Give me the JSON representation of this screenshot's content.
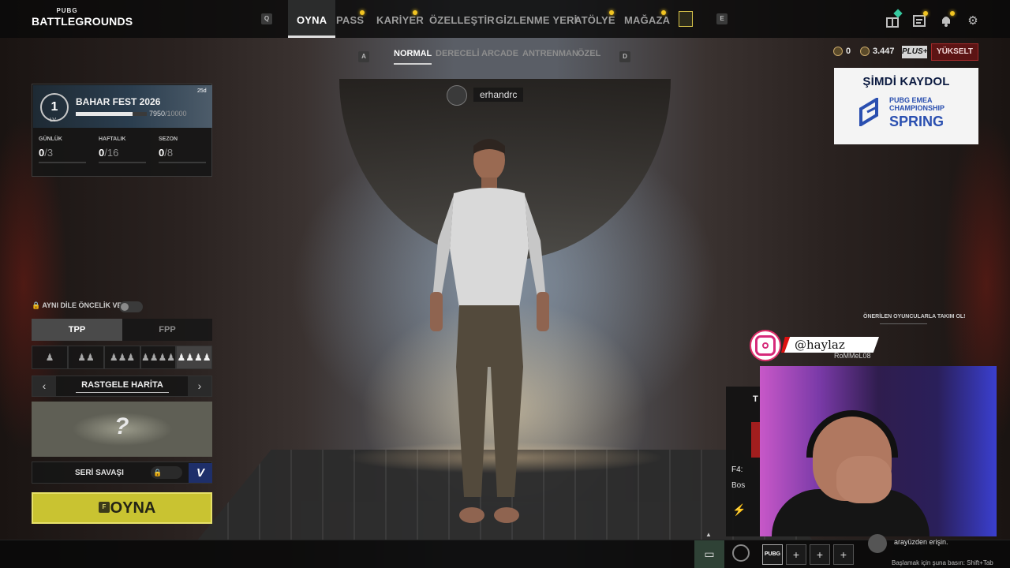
{
  "brand": {
    "small": "PUBG",
    "big": "BATTLEGROUNDS"
  },
  "nav": {
    "left_key": "Q",
    "right_key": "E",
    "items": [
      {
        "label": "OYNA",
        "active": true
      },
      {
        "label": "PASS",
        "dot": true
      },
      {
        "label": "KARİYER",
        "dot": true
      },
      {
        "label": "ÖZELLEŞTİR"
      },
      {
        "label": "GİZLENME YERİ"
      },
      {
        "label": "ATÖLYE",
        "dot": true
      },
      {
        "label": "MAĞAZA",
        "dot": true
      }
    ]
  },
  "modes": {
    "left_key": "A",
    "right_key": "D",
    "items": [
      "NORMAL",
      "DERECELİ",
      "ARCADE",
      "ANTRENMAN",
      "ÖZEL"
    ],
    "active": "NORMAL"
  },
  "currency": {
    "gcoin": "0",
    "bp": "3.447",
    "plus": "PLUS+",
    "upgrade": "YÜKSELT"
  },
  "ad": {
    "title": "ŞİMDİ KAYDOL",
    "line1": "PUBG EMEA",
    "line2": "CHAMPIONSHIP",
    "line3": "SPRING"
  },
  "player": {
    "name": "erhandrc"
  },
  "event": {
    "level": "1",
    "level_label": "LV",
    "title": "BAHAR FEST 2026",
    "progress_current": "7950",
    "progress_total": "/10000",
    "progress_fraction": 0.795,
    "days": "25d",
    "stats": [
      {
        "label": "GÜNLÜK",
        "value": "0",
        "max": "/3"
      },
      {
        "label": "HAFTALIK",
        "value": "0",
        "max": "/16"
      },
      {
        "label": "SEZON",
        "value": "0",
        "max": "/8"
      }
    ]
  },
  "lobby": {
    "lang_pref": "AYNI DİLE ÖNCELİK VER",
    "perspectives": [
      "TPP",
      "FPP"
    ],
    "active_perspective": "TPP",
    "map": "RASTGELE HARİTA",
    "series": "SERİ SAVAŞI",
    "series_badge": "V",
    "play_key": "F",
    "play_label": "OYNA"
  },
  "overlay": {
    "recommend": "ÖNERİLEN OYUNCULARLA TAKIM OL!",
    "handle": "@haylaz",
    "rommel": "RoMMeL08",
    "partial_t": "T",
    "partial_f4": "F4:",
    "partial_bos": "Bos"
  },
  "bottom": {
    "pubg_slot": "PUBG",
    "add": "+",
    "steam_line": "arayüzden erişin.",
    "shortcut": "Başlamak için şuna basın: Shift+Tab"
  },
  "colors": {
    "play": "#c9c331",
    "upgrade": "#5c1414",
    "notify": "#f2c522"
  }
}
